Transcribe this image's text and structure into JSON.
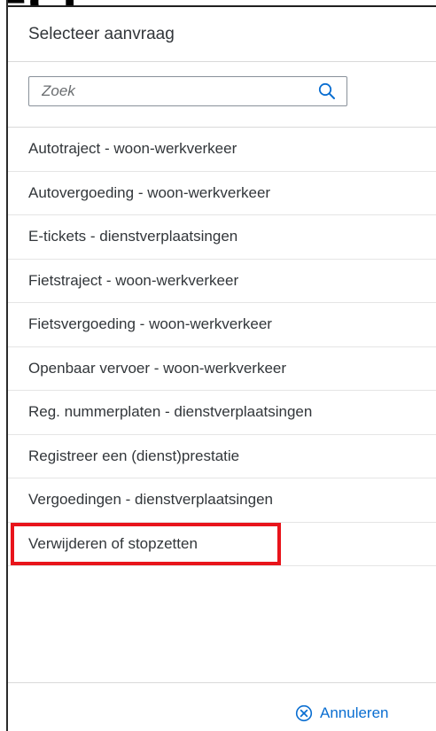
{
  "background": {
    "heading_fragment": "ect"
  },
  "dialog": {
    "title": "Selecteer aanvraag",
    "search": {
      "placeholder": "Zoek",
      "value": ""
    },
    "items": [
      {
        "label": "Autotraject - woon-werkverkeer"
      },
      {
        "label": "Autovergoeding - woon-werkverkeer"
      },
      {
        "label": "E-tickets - dienstverplaatsingen"
      },
      {
        "label": "Fietstraject - woon-werkverkeer"
      },
      {
        "label": "Fietsvergoeding - woon-werkverkeer"
      },
      {
        "label": "Openbaar vervoer - woon-werkverkeer"
      },
      {
        "label": "Reg. nummerplaten - dienstverplaatsingen"
      },
      {
        "label": "Registreer een (dienst)prestatie"
      },
      {
        "label": "Vergoedingen - dienstverplaatsingen"
      },
      {
        "label": "Verwijderen of stopzetten",
        "highlighted": true
      }
    ],
    "footer": {
      "cancel_label": "Annuleren"
    }
  },
  "colors": {
    "accent": "#0a6ed1",
    "text": "#32363a",
    "highlight_box": "#e8141b",
    "border": "#d9d9d9"
  },
  "icons": {
    "search": "search-icon",
    "cancel": "close-circle-icon"
  }
}
